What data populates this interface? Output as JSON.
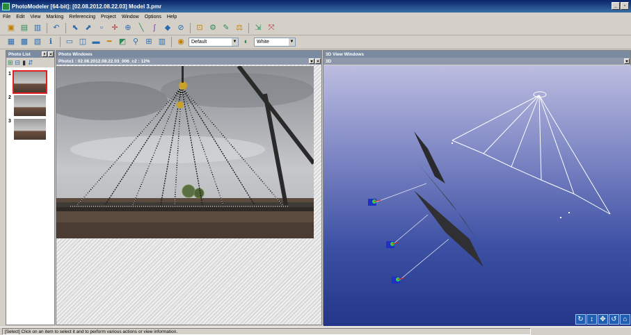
{
  "app": {
    "title": "PhotoModeler [64-bit]: [02.08.2012.08.22.03] Model 3.pmr"
  },
  "menu": [
    "File",
    "Edit",
    "View",
    "Marking",
    "Referencing",
    "Project",
    "Window",
    "Options",
    "Help"
  ],
  "toolbar2": {
    "style_combo": "Default",
    "color_combo": "White"
  },
  "photo_list": {
    "title": "Photo List",
    "thumbs": [
      {
        "num": "1",
        "selected": true
      },
      {
        "num": "2",
        "selected": false
      },
      {
        "num": "3",
        "selected": false
      }
    ]
  },
  "photo_windows": {
    "title": "Photo Windows",
    "photo_title": "Photo1 : 02.08.2012.08.22.03_006_c2 : 12%"
  },
  "view3d_windows": {
    "title": "3D View Windows",
    "view_title": "3D"
  },
  "status": {
    "text": "[Select] Click on an item to select it and to perform various actions or view information."
  },
  "colors": {
    "titlebar": "#0a246a",
    "panel_title": "#7a8aa0",
    "view_bg_top": "#bcbde0",
    "view_bg_bottom": "#23368a",
    "selection": "#e02020"
  }
}
